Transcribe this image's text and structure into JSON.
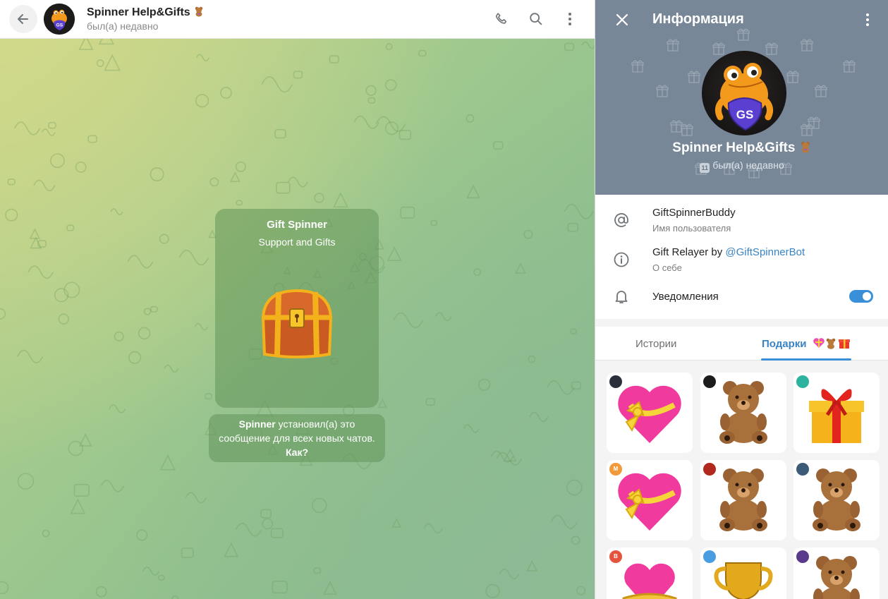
{
  "chat_header": {
    "title": "Spinner Help&Gifts",
    "title_emoji_icon": "teddy-bear-emoji",
    "status": "был(а) недавно",
    "icons": [
      "back-arrow-icon",
      "phone-icon",
      "search-icon",
      "more-vertical-icon"
    ]
  },
  "welcome_card": {
    "title": "Gift Spinner",
    "subtitle": "Support and Gifts",
    "image_icon": "treasure-chest-icon"
  },
  "service_message": {
    "actor": "Spinner",
    "text": " установил(а) это сообщение для всех новых чатов. ",
    "link": "Как?"
  },
  "info_panel": {
    "title": "Информация",
    "avatar_text": "GS",
    "name": "Spinner Help&Gifts",
    "status_badge": "11",
    "status": "был(а) недавно",
    "username": "GiftSpinnerBuddy",
    "username_label": "Имя пользователя",
    "bio_text": "Gift Relayer by ",
    "bio_link": "@GiftSpinnerBot",
    "bio_label": "О себе",
    "notifications_label": "Уведомления",
    "notifications_on": true
  },
  "tabs": {
    "stories": "Истории",
    "gifts": "Подарки"
  },
  "gifts": [
    {
      "type": "heart-with-ribbon",
      "sender_color": "#2a2f3a",
      "sender_initial": ""
    },
    {
      "type": "teddy-bear",
      "sender_color": "#1c1c1c",
      "sender_initial": ""
    },
    {
      "type": "gift-box",
      "sender_color": "#2bb3a0",
      "sender_initial": ""
    },
    {
      "type": "heart-with-ribbon",
      "sender_color": "#f29a3b",
      "sender_initial": "M"
    },
    {
      "type": "teddy-bear",
      "sender_color": "#b0281e",
      "sender_initial": ""
    },
    {
      "type": "teddy-bear",
      "sender_color": "#3d5a78",
      "sender_initial": ""
    },
    {
      "type": "heart-box",
      "sender_color": "#e5533d",
      "sender_initial": "B"
    },
    {
      "type": "trophy",
      "sender_color": "#4a9de0",
      "sender_initial": ""
    },
    {
      "type": "teddy-bear",
      "sender_color": "#5a3a8a",
      "sender_initial": ""
    }
  ],
  "colors": {
    "accent": "#3a8fd9",
    "hero_bg": "#788797",
    "bubble": "#62965a"
  }
}
